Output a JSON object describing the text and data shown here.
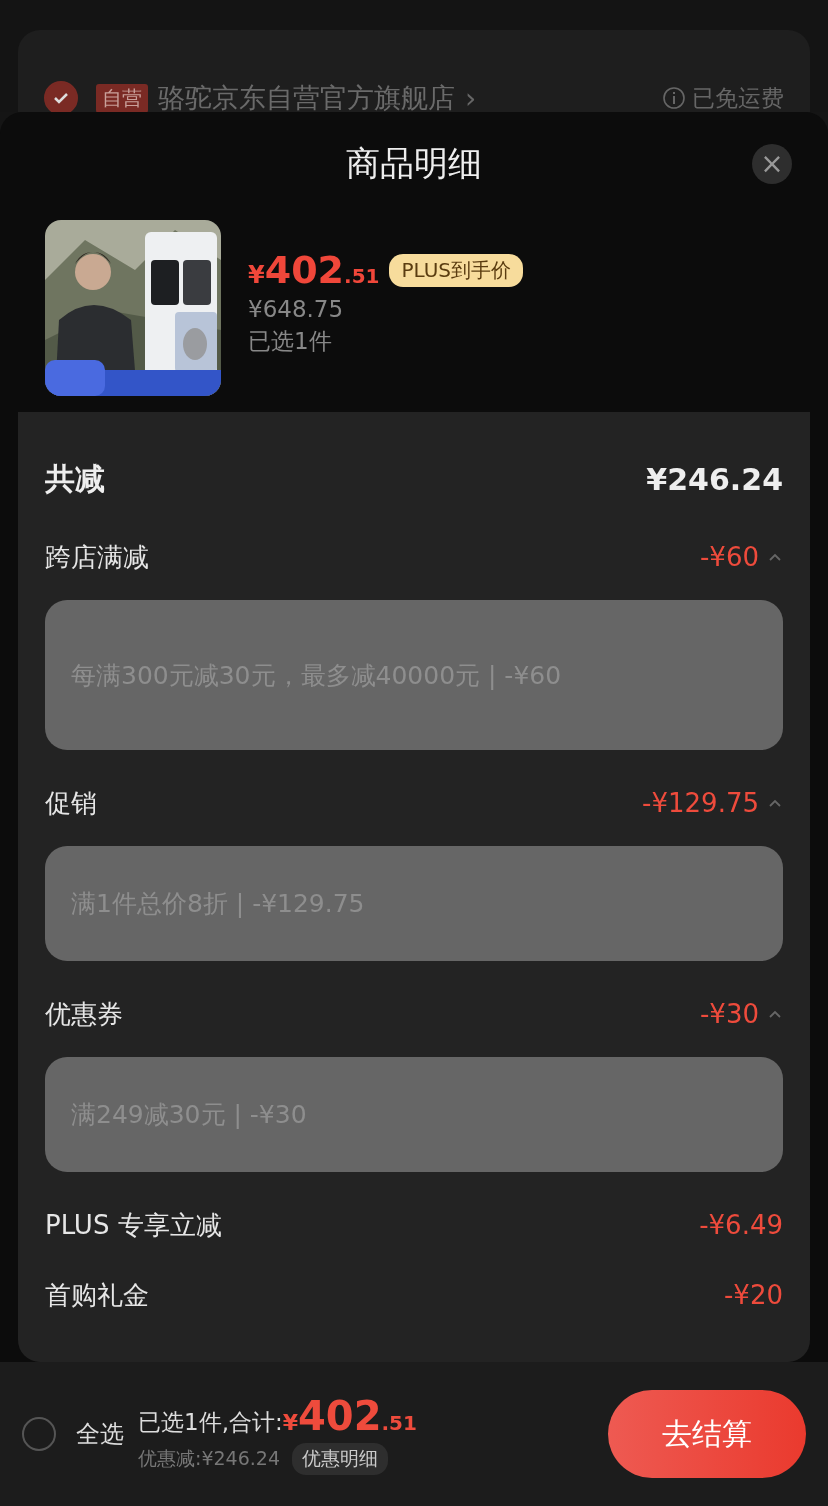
{
  "background": {
    "store": {
      "checked": true,
      "badge": "自营",
      "name": "骆驼京东自营官方旗舰店",
      "chevron": "›",
      "shipping": "已免运费"
    }
  },
  "sheet": {
    "title": "商品明细",
    "close": "×",
    "product": {
      "price_symbol": "¥",
      "price_int": "402",
      "price_dec": ".51",
      "tag": "PLUS到手价",
      "original_price": "¥648.75",
      "selected_count": "已选1件"
    },
    "summary": {
      "label": "共减",
      "amount": "¥246.24"
    },
    "discounts": [
      {
        "kind": "expandable",
        "label": "跨店满减",
        "amount": "-¥60",
        "expanded": true,
        "detail": "每满300元减30元，最多减40000元 | -¥60"
      },
      {
        "kind": "expandable",
        "label": "促销",
        "amount": "-¥129.75",
        "expanded": true,
        "detail": "满1件总价8折 | -¥129.75"
      },
      {
        "kind": "expandable",
        "label": "优惠券",
        "amount": "-¥30",
        "expanded": true,
        "detail": "满249减30元 | -¥30"
      },
      {
        "kind": "plain",
        "label": "PLUS 专享立减",
        "amount": "-¥6.49"
      },
      {
        "kind": "plain",
        "label": "首购礼金",
        "amount": "-¥20"
      }
    ]
  },
  "bottom_bar": {
    "select_all": {
      "checked": false,
      "label": "全选"
    },
    "total_label": "已选1件,合计:",
    "total_symbol": "¥",
    "total_int": "402",
    "total_dec": ".51",
    "discount": "优惠减:¥246.24",
    "details_button": "优惠明细",
    "checkout": "去结算"
  }
}
